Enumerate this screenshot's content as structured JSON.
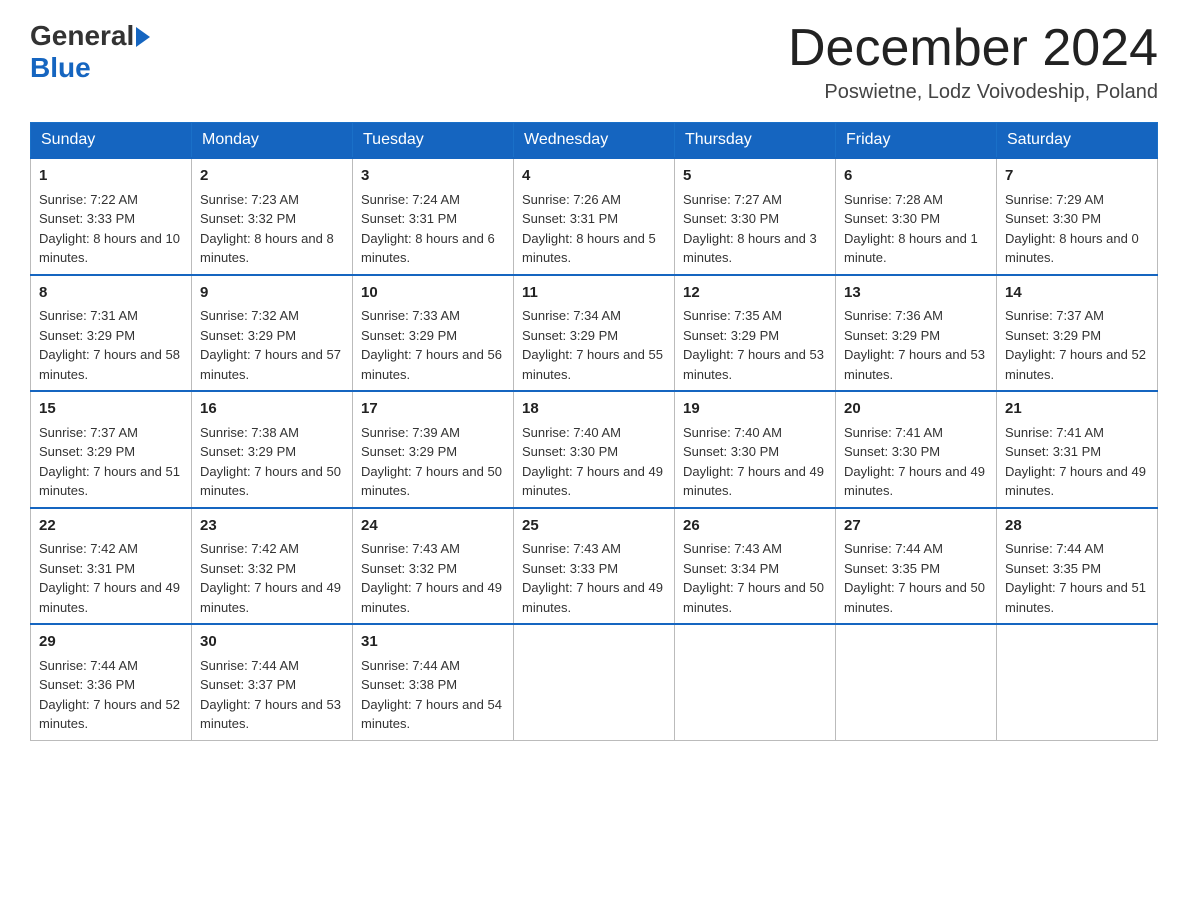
{
  "header": {
    "logo_general": "General",
    "logo_blue": "Blue",
    "month_title": "December 2024",
    "subtitle": "Poswietne, Lodz Voivodeship, Poland"
  },
  "days_of_week": [
    "Sunday",
    "Monday",
    "Tuesday",
    "Wednesday",
    "Thursday",
    "Friday",
    "Saturday"
  ],
  "weeks": [
    [
      {
        "day": "1",
        "sunrise": "7:22 AM",
        "sunset": "3:33 PM",
        "daylight": "8 hours and 10 minutes."
      },
      {
        "day": "2",
        "sunrise": "7:23 AM",
        "sunset": "3:32 PM",
        "daylight": "8 hours and 8 minutes."
      },
      {
        "day": "3",
        "sunrise": "7:24 AM",
        "sunset": "3:31 PM",
        "daylight": "8 hours and 6 minutes."
      },
      {
        "day": "4",
        "sunrise": "7:26 AM",
        "sunset": "3:31 PM",
        "daylight": "8 hours and 5 minutes."
      },
      {
        "day": "5",
        "sunrise": "7:27 AM",
        "sunset": "3:30 PM",
        "daylight": "8 hours and 3 minutes."
      },
      {
        "day": "6",
        "sunrise": "7:28 AM",
        "sunset": "3:30 PM",
        "daylight": "8 hours and 1 minute."
      },
      {
        "day": "7",
        "sunrise": "7:29 AM",
        "sunset": "3:30 PM",
        "daylight": "8 hours and 0 minutes."
      }
    ],
    [
      {
        "day": "8",
        "sunrise": "7:31 AM",
        "sunset": "3:29 PM",
        "daylight": "7 hours and 58 minutes."
      },
      {
        "day": "9",
        "sunrise": "7:32 AM",
        "sunset": "3:29 PM",
        "daylight": "7 hours and 57 minutes."
      },
      {
        "day": "10",
        "sunrise": "7:33 AM",
        "sunset": "3:29 PM",
        "daylight": "7 hours and 56 minutes."
      },
      {
        "day": "11",
        "sunrise": "7:34 AM",
        "sunset": "3:29 PM",
        "daylight": "7 hours and 55 minutes."
      },
      {
        "day": "12",
        "sunrise": "7:35 AM",
        "sunset": "3:29 PM",
        "daylight": "7 hours and 53 minutes."
      },
      {
        "day": "13",
        "sunrise": "7:36 AM",
        "sunset": "3:29 PM",
        "daylight": "7 hours and 53 minutes."
      },
      {
        "day": "14",
        "sunrise": "7:37 AM",
        "sunset": "3:29 PM",
        "daylight": "7 hours and 52 minutes."
      }
    ],
    [
      {
        "day": "15",
        "sunrise": "7:37 AM",
        "sunset": "3:29 PM",
        "daylight": "7 hours and 51 minutes."
      },
      {
        "day": "16",
        "sunrise": "7:38 AM",
        "sunset": "3:29 PM",
        "daylight": "7 hours and 50 minutes."
      },
      {
        "day": "17",
        "sunrise": "7:39 AM",
        "sunset": "3:29 PM",
        "daylight": "7 hours and 50 minutes."
      },
      {
        "day": "18",
        "sunrise": "7:40 AM",
        "sunset": "3:30 PM",
        "daylight": "7 hours and 49 minutes."
      },
      {
        "day": "19",
        "sunrise": "7:40 AM",
        "sunset": "3:30 PM",
        "daylight": "7 hours and 49 minutes."
      },
      {
        "day": "20",
        "sunrise": "7:41 AM",
        "sunset": "3:30 PM",
        "daylight": "7 hours and 49 minutes."
      },
      {
        "day": "21",
        "sunrise": "7:41 AM",
        "sunset": "3:31 PM",
        "daylight": "7 hours and 49 minutes."
      }
    ],
    [
      {
        "day": "22",
        "sunrise": "7:42 AM",
        "sunset": "3:31 PM",
        "daylight": "7 hours and 49 minutes."
      },
      {
        "day": "23",
        "sunrise": "7:42 AM",
        "sunset": "3:32 PM",
        "daylight": "7 hours and 49 minutes."
      },
      {
        "day": "24",
        "sunrise": "7:43 AM",
        "sunset": "3:32 PM",
        "daylight": "7 hours and 49 minutes."
      },
      {
        "day": "25",
        "sunrise": "7:43 AM",
        "sunset": "3:33 PM",
        "daylight": "7 hours and 49 minutes."
      },
      {
        "day": "26",
        "sunrise": "7:43 AM",
        "sunset": "3:34 PM",
        "daylight": "7 hours and 50 minutes."
      },
      {
        "day": "27",
        "sunrise": "7:44 AM",
        "sunset": "3:35 PM",
        "daylight": "7 hours and 50 minutes."
      },
      {
        "day": "28",
        "sunrise": "7:44 AM",
        "sunset": "3:35 PM",
        "daylight": "7 hours and 51 minutes."
      }
    ],
    [
      {
        "day": "29",
        "sunrise": "7:44 AM",
        "sunset": "3:36 PM",
        "daylight": "7 hours and 52 minutes."
      },
      {
        "day": "30",
        "sunrise": "7:44 AM",
        "sunset": "3:37 PM",
        "daylight": "7 hours and 53 minutes."
      },
      {
        "day": "31",
        "sunrise": "7:44 AM",
        "sunset": "3:38 PM",
        "daylight": "7 hours and 54 minutes."
      },
      null,
      null,
      null,
      null
    ]
  ]
}
